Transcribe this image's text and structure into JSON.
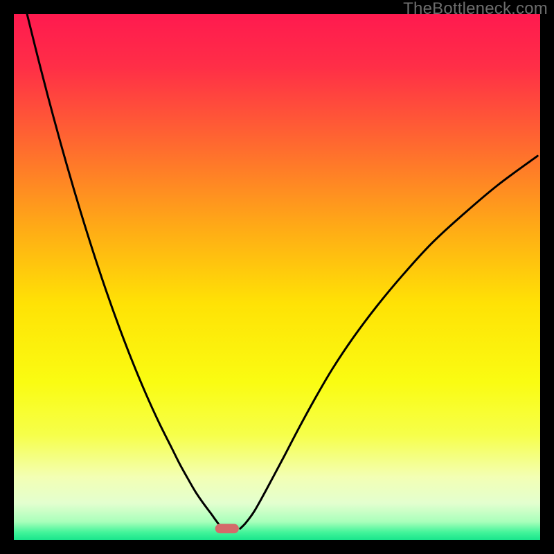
{
  "watermark": "TheBottleneck.com",
  "chart_data": {
    "type": "line",
    "title": "",
    "xlabel": "",
    "ylabel": "",
    "xlim": [
      0,
      100
    ],
    "ylim": [
      0,
      100
    ],
    "grid": false,
    "gradient_stops": [
      {
        "offset": 0.0,
        "color": "#ff1a4f"
      },
      {
        "offset": 0.1,
        "color": "#ff2e47"
      },
      {
        "offset": 0.25,
        "color": "#ff6a2f"
      },
      {
        "offset": 0.4,
        "color": "#ffa817"
      },
      {
        "offset": 0.55,
        "color": "#ffe205"
      },
      {
        "offset": 0.7,
        "color": "#fafc12"
      },
      {
        "offset": 0.8,
        "color": "#f6ff4a"
      },
      {
        "offset": 0.88,
        "color": "#f3ffb4"
      },
      {
        "offset": 0.93,
        "color": "#e3ffcf"
      },
      {
        "offset": 0.965,
        "color": "#a9ffbb"
      },
      {
        "offset": 0.985,
        "color": "#43f49a"
      },
      {
        "offset": 1.0,
        "color": "#18e58c"
      }
    ],
    "marker": {
      "x_fraction": 0.405,
      "y_fraction": 0.978,
      "width_fraction": 0.045,
      "height_fraction": 0.018,
      "color": "#d46a6a",
      "rx_fraction": 0.009
    },
    "series": [
      {
        "name": "left-curve",
        "x": [
          2.5,
          5,
          7.5,
          10,
          12.5,
          15,
          17.5,
          20,
          22.5,
          25,
          27.5,
          30,
          31.5,
          33,
          34.5,
          36,
          37.5,
          38.5,
          39.3,
          40
        ],
        "y": [
          100,
          90,
          80.5,
          71.5,
          63,
          55,
          47.5,
          40.5,
          34,
          28,
          22.5,
          17.5,
          14.5,
          11.8,
          9.2,
          7,
          5,
          3.6,
          2.6,
          2.2
        ]
      },
      {
        "name": "right-curve",
        "x": [
          43,
          44,
          45.5,
          47,
          49,
          51.5,
          54,
          57,
          60.5,
          64.5,
          69,
          74,
          79.5,
          85.5,
          92,
          99.5
        ],
        "y": [
          2.2,
          3.2,
          5.2,
          7.8,
          11.5,
          16.2,
          21,
          26.5,
          32.5,
          38.5,
          44.5,
          50.5,
          56.5,
          62,
          67.5,
          73
        ]
      }
    ],
    "curve_stroke": "#000000",
    "curve_stroke_width": 3
  }
}
